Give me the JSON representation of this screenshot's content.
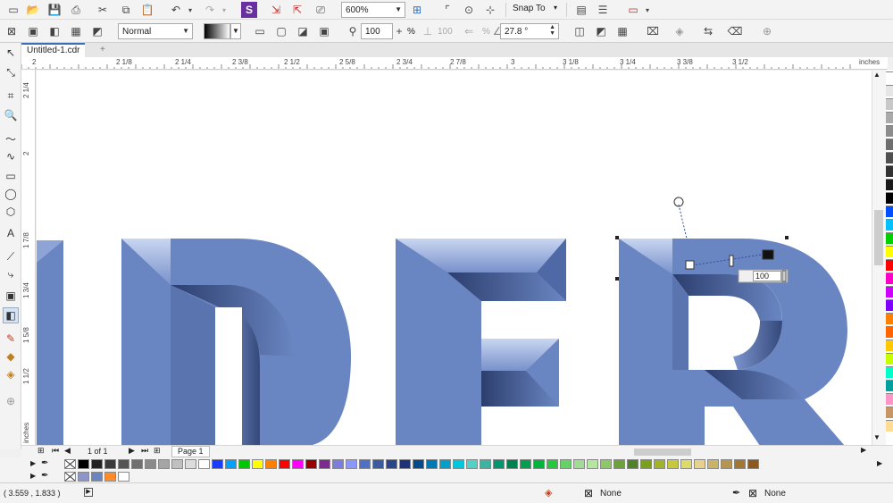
{
  "toolbar": {
    "zoom_value": "600%",
    "snap_label": "Snap To",
    "mode_value": "Normal",
    "transparency_value": "100",
    "transparency_unit": "%",
    "transparency_value_2": "100",
    "transparency_unit_2": "%",
    "angle_value": "27.8 °"
  },
  "tabs": [
    {
      "label": "Untitled-1.cdr"
    }
  ],
  "ruler": {
    "unit": "inches",
    "h_labels": [
      "2",
      "2 1/8",
      "2 1/4",
      "2 3/8",
      "2 1/2",
      "2 5/8",
      "2 3/4",
      "2 7/8",
      "3",
      "3 1/8",
      "3 1/4",
      "3 3/8",
      "3 1/2"
    ],
    "v_labels": [
      "2 1/4",
      "2",
      "1 7/8",
      "1 3/4",
      "1 5/8",
      "1 1/2",
      "inches"
    ]
  },
  "canvas": {
    "text": "IDFR",
    "letter_color": "#6a86c2",
    "handle_value": "100"
  },
  "page_nav": {
    "counter": "1 of 1",
    "page_tab": "Page 1"
  },
  "status": {
    "coords": "( 3.559 , 1.833 )",
    "fill_label": "None",
    "outline_label": "None"
  },
  "palette_colors": [
    "#000000",
    "#222222",
    "#3a3a3a",
    "#555555",
    "#707070",
    "#8a8a8a",
    "#a5a5a5",
    "#c0c0c0",
    "#dcdcdc",
    "#ffffff",
    "#1a3cff",
    "#00a0ff",
    "#00c800",
    "#ffff00",
    "#ff8000",
    "#ff0000",
    "#ff00ff",
    "#9b0000",
    "#7b2c8c",
    "#7d7de0",
    "#8c96ff",
    "#5070c8",
    "#3c5aa0",
    "#28468c",
    "#1e3278",
    "#004b8c",
    "#0078b4",
    "#00a0c8",
    "#00c8dc",
    "#50d2c8",
    "#3cb4a0",
    "#00966e",
    "#008250",
    "#00a050",
    "#00b43c",
    "#28c83c",
    "#64d264",
    "#a0dc96",
    "#b4e6a0",
    "#8cc864",
    "#6ea03c",
    "#508228",
    "#78a01e",
    "#a0b428",
    "#c8c83c",
    "#dcdc64",
    "#e6d28c",
    "#c8b464",
    "#b49650",
    "#a07830",
    "#8c5a1e"
  ],
  "palette_row2": [
    "#8c96c8",
    "#6a86c2",
    "#ff8c28",
    "#ffffff"
  ],
  "right_palette": [
    "#ffffff",
    "#e6e6e6",
    "#c8c8c8",
    "#aaaaaa",
    "#8c8c8c",
    "#6e6e6e",
    "#505050",
    "#323232",
    "#1a1a1a",
    "#000000",
    "#0050ff",
    "#00c0ff",
    "#00d000",
    "#ffff00",
    "#ff0000",
    "#ff00c8",
    "#d000ff",
    "#8000ff",
    "#ff8000",
    "#ff6400",
    "#ffc800",
    "#c8ff00",
    "#00ffc8",
    "#00a0a0",
    "#ff96c8",
    "#c89664",
    "#ffdc96"
  ]
}
